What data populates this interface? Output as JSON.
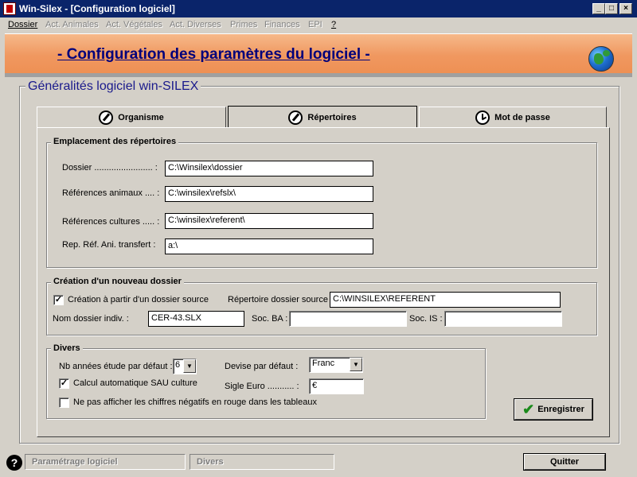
{
  "window": {
    "title": "Win-Silex - [Configuration logiciel]",
    "controls": {
      "minimize": "_",
      "maximize": "□",
      "close": "×"
    }
  },
  "menu": [
    {
      "label": "Dossier",
      "enabled": true
    },
    {
      "label": "Act. Animales",
      "enabled": false
    },
    {
      "label": "Act. Végétales",
      "enabled": false
    },
    {
      "label": "Act. Diverses",
      "enabled": false
    },
    {
      "label": "Primes",
      "enabled": false
    },
    {
      "label": "Finances",
      "enabled": false
    },
    {
      "label": "EPI",
      "enabled": false
    },
    {
      "label": "?",
      "enabled": true
    }
  ],
  "header": {
    "title": "- Configuration des paramètres du logiciel -",
    "icon": "globe-icon"
  },
  "main": {
    "group_title": "Généralités logiciel win-SILEX",
    "tabs": [
      {
        "label": "Organisme",
        "icon": "wrench-icon",
        "active": false
      },
      {
        "label": "Répertoires",
        "icon": "wrench-icon",
        "active": true
      },
      {
        "label": "Mot de passe",
        "icon": "clock-icon",
        "active": false
      }
    ]
  },
  "emplacement": {
    "legend": "Emplacement des répertoires",
    "fields": [
      {
        "label": "Dossier  ........................ :",
        "value": "C:\\Winsilex\\dossier"
      },
      {
        "label": "Références animaux .... :",
        "value": "C:\\winsilex\\refslx\\"
      },
      {
        "label": "Références cultures ..... :",
        "value": "C:\\winsilex\\referent\\"
      },
      {
        "label": "Rep. Réf. Ani. transfert  :",
        "value": "a:\\"
      }
    ]
  },
  "creation": {
    "legend": "Création d'un nouveau dossier",
    "from_source_label": "Création à partir d'un dossier source",
    "from_source_checked": true,
    "source_dir_label": "Répertoire dossier source :",
    "source_dir_value": "C:\\WINSILEX\\REFERENT",
    "nom_label": "Nom dossier indiv. :",
    "nom_value": "CER-43.SLX",
    "soc_ba_label": "Soc. BA :",
    "soc_ba_value": "",
    "soc_is_label": "Soc. IS :",
    "soc_is_value": ""
  },
  "divers": {
    "legend": "Divers",
    "nb_annees_label": "Nb années étude par défaut :",
    "nb_annees_value": "6",
    "devise_label": "Devise par défaut :",
    "devise_value": "Franc",
    "sau_label": "Calcul automatique SAU culture",
    "sau_checked": true,
    "sigle_label": "Sigle Euro ........... :",
    "sigle_value": "€",
    "negatifs_label": "Ne pas afficher les chiffres négatifs en rouge dans les tableaux",
    "negatifs_checked": false
  },
  "actions": {
    "save_label": "Enregistrer"
  },
  "statusbar": {
    "help": "?",
    "field1": "Paramétrage logiciel",
    "field2": "Divers",
    "quit_label": "Quitter"
  }
}
